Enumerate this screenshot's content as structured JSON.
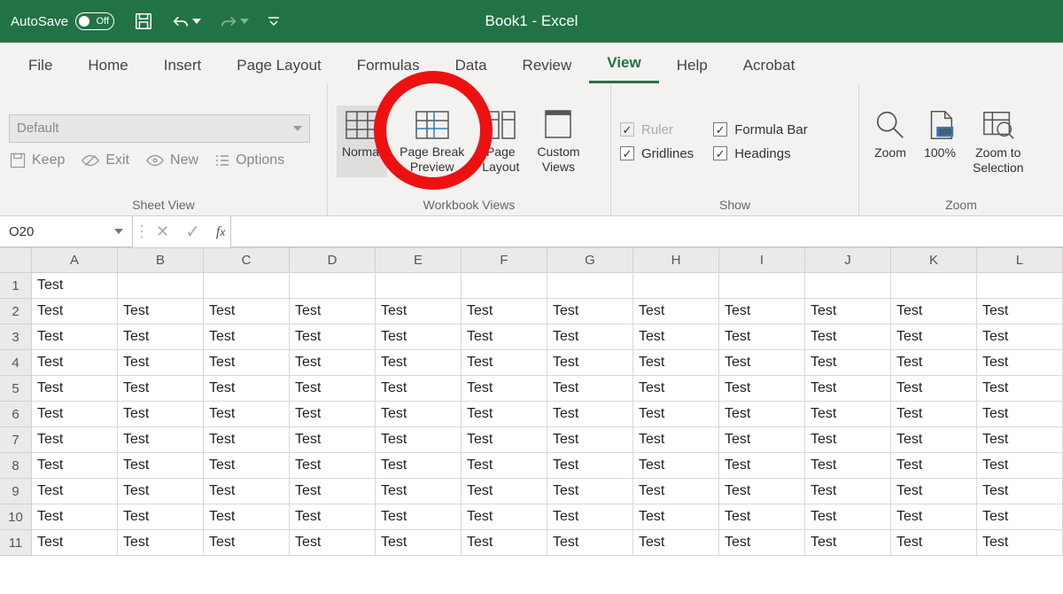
{
  "title": "Book1  -  Excel",
  "autosave": {
    "label": "AutoSave",
    "state": "Off"
  },
  "tabs": [
    "File",
    "Home",
    "Insert",
    "Page Layout",
    "Formulas",
    "Data",
    "Review",
    "View",
    "Help",
    "Acrobat"
  ],
  "active_tab": "View",
  "sheetview": {
    "default": "Default",
    "keep": "Keep",
    "exit": "Exit",
    "new": "New",
    "options": "Options",
    "group_label": "Sheet View"
  },
  "workbook_views": {
    "normal": "Normal",
    "pagebreak": "Page Break\nPreview",
    "pagelayout": "Page\nLayout",
    "custom": "Custom\nViews",
    "group_label": "Workbook Views"
  },
  "show": {
    "ruler": "Ruler",
    "formula_bar": "Formula Bar",
    "gridlines": "Gridlines",
    "headings": "Headings",
    "group_label": "Show"
  },
  "zoom": {
    "zoom": "Zoom",
    "hundred": "100%",
    "selection": "Zoom to\nSelection",
    "group_label": "Zoom"
  },
  "namebox": "O20",
  "columns": [
    "A",
    "B",
    "C",
    "D",
    "E",
    "F",
    "G",
    "H",
    "I",
    "J",
    "K",
    "L"
  ],
  "rows": [
    {
      "n": "1",
      "cells": [
        "Test",
        "",
        "",
        "",
        "",
        "",
        "",
        "",
        "",
        "",
        "",
        ""
      ]
    },
    {
      "n": "2",
      "cells": [
        "Test",
        "Test",
        "Test",
        "Test",
        "Test",
        "Test",
        "Test",
        "Test",
        "Test",
        "Test",
        "Test",
        "Test"
      ]
    },
    {
      "n": "3",
      "cells": [
        "Test",
        "Test",
        "Test",
        "Test",
        "Test",
        "Test",
        "Test",
        "Test",
        "Test",
        "Test",
        "Test",
        "Test"
      ]
    },
    {
      "n": "4",
      "cells": [
        "Test",
        "Test",
        "Test",
        "Test",
        "Test",
        "Test",
        "Test",
        "Test",
        "Test",
        "Test",
        "Test",
        "Test"
      ]
    },
    {
      "n": "5",
      "cells": [
        "Test",
        "Test",
        "Test",
        "Test",
        "Test",
        "Test",
        "Test",
        "Test",
        "Test",
        "Test",
        "Test",
        "Test"
      ]
    },
    {
      "n": "6",
      "cells": [
        "Test",
        "Test",
        "Test",
        "Test",
        "Test",
        "Test",
        "Test",
        "Test",
        "Test",
        "Test",
        "Test",
        "Test"
      ]
    },
    {
      "n": "7",
      "cells": [
        "Test",
        "Test",
        "Test",
        "Test",
        "Test",
        "Test",
        "Test",
        "Test",
        "Test",
        "Test",
        "Test",
        "Test"
      ]
    },
    {
      "n": "8",
      "cells": [
        "Test",
        "Test",
        "Test",
        "Test",
        "Test",
        "Test",
        "Test",
        "Test",
        "Test",
        "Test",
        "Test",
        "Test"
      ]
    },
    {
      "n": "9",
      "cells": [
        "Test",
        "Test",
        "Test",
        "Test",
        "Test",
        "Test",
        "Test",
        "Test",
        "Test",
        "Test",
        "Test",
        "Test"
      ]
    },
    {
      "n": "10",
      "cells": [
        "Test",
        "Test",
        "Test",
        "Test",
        "Test",
        "Test",
        "Test",
        "Test",
        "Test",
        "Test",
        "Test",
        "Test"
      ]
    },
    {
      "n": "11",
      "cells": [
        "Test",
        "Test",
        "Test",
        "Test",
        "Test",
        "Test",
        "Test",
        "Test",
        "Test",
        "Test",
        "Test",
        "Test"
      ]
    }
  ]
}
